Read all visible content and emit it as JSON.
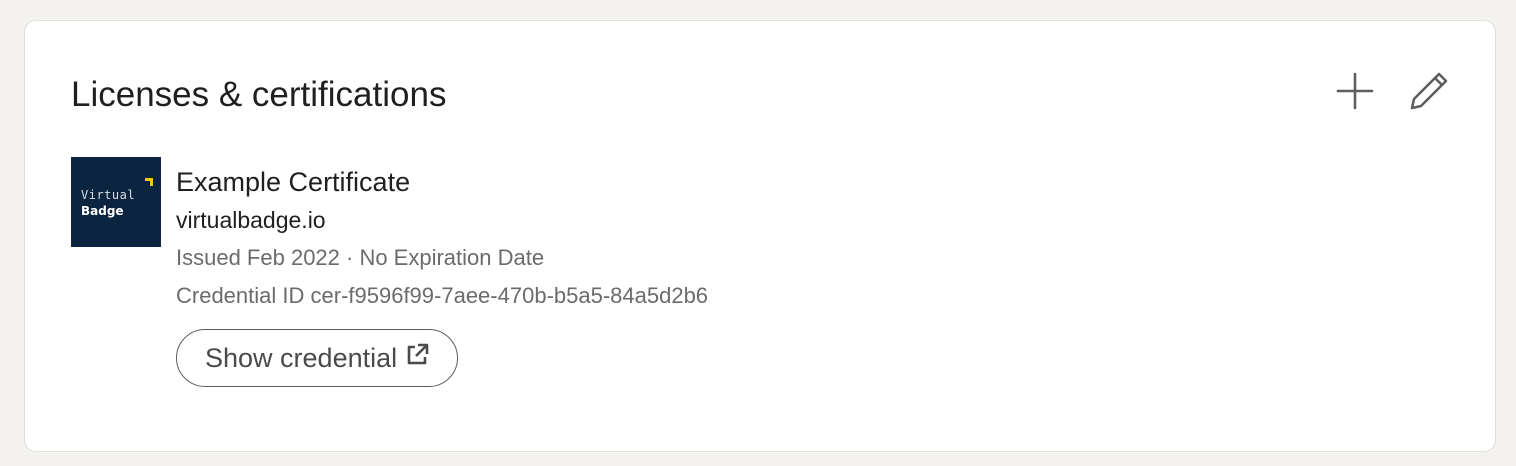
{
  "section": {
    "title": "Licenses & certifications",
    "actions": [
      {
        "icon": "plus-icon",
        "label": "Add"
      },
      {
        "icon": "pencil-icon",
        "label": "Edit"
      }
    ]
  },
  "certificate": {
    "logo": {
      "line1": "Virtual",
      "line2": "Badge",
      "background": "#0b2440",
      "accent": "#f5c400"
    },
    "name": "Example Certificate",
    "issuer": "virtualbadge.io",
    "issued": "Issued Feb 2022 · No Expiration Date",
    "credential_id": "Credential ID cer-f9596f99-7aee-470b-b5a5-84a5d2b6",
    "show_credential_label": "Show credential",
    "show_credential_icon": "external-link-icon"
  },
  "colors": {
    "page_background": "#f3f2ef",
    "card_background": "#ffffff",
    "primary_text": "#1f1f1f",
    "secondary_text": "#6b6b6b"
  }
}
